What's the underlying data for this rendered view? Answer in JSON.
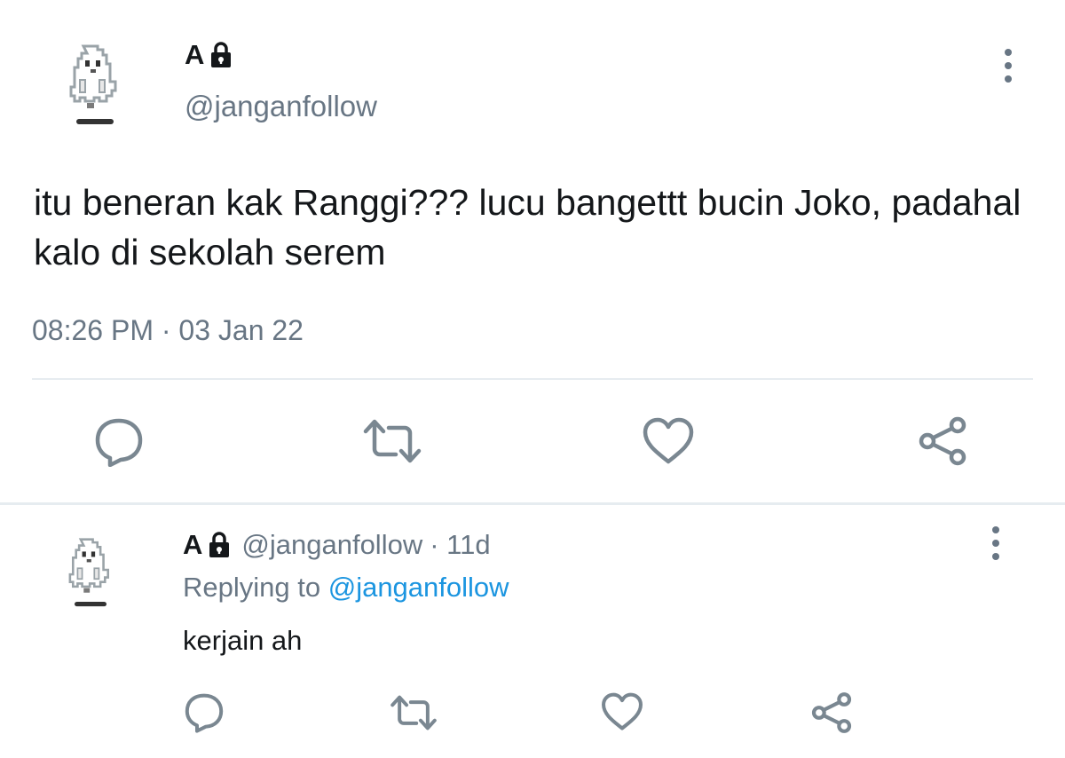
{
  "main_tweet": {
    "name": "A",
    "handle": "@janganfollow",
    "text": "itu beneran kak Ranggi??? lucu bangettt bucin Joko, padahal kalo di sekolah serem",
    "timestamp": "08:26 PM · 03 Jan 22",
    "icons": [
      "lock-icon",
      "more-vertical-icon",
      "reply-icon",
      "retweet-icon",
      "like-icon",
      "share-icon"
    ]
  },
  "reply_tweet": {
    "name": "A",
    "handle": "@janganfollow",
    "age": "· 11d",
    "replying_prefix": "Replying to",
    "replying_handle": "@janganfollow",
    "text": "kerjain ah"
  },
  "colors": {
    "text": "#14171a",
    "secondary": "#687684",
    "link": "#1b95e0",
    "icon": "#7a8791",
    "divider": "#e6ecf0"
  }
}
